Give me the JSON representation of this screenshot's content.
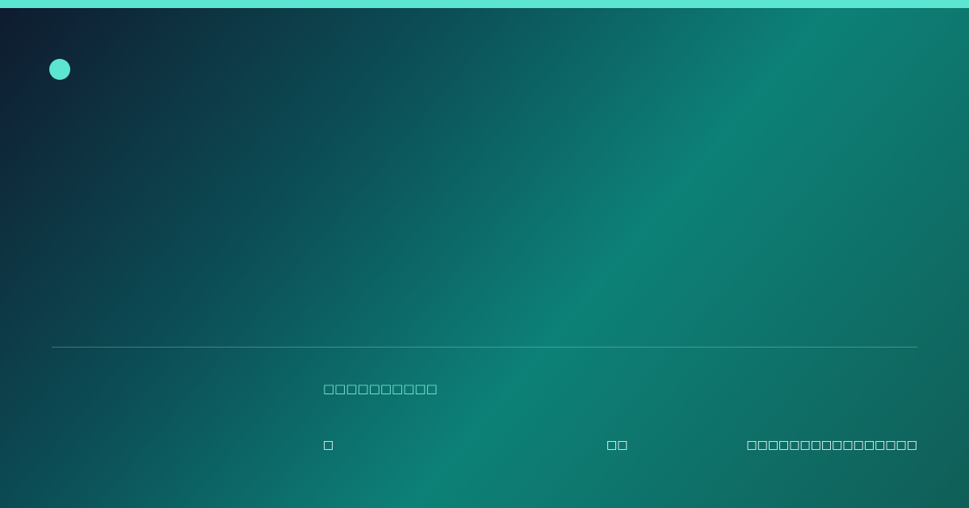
{
  "colors": {
    "accent": "#5ce6d1",
    "gradient": [
      "#0f1a2e",
      "#0c4d55",
      "#0d8177",
      "#105e58"
    ]
  },
  "card": {
    "tagline": "□□□□□□□□□□",
    "footer": {
      "left": "□",
      "middle": "□□",
      "right": "□□□□□□□□□□□□□□□□"
    }
  }
}
